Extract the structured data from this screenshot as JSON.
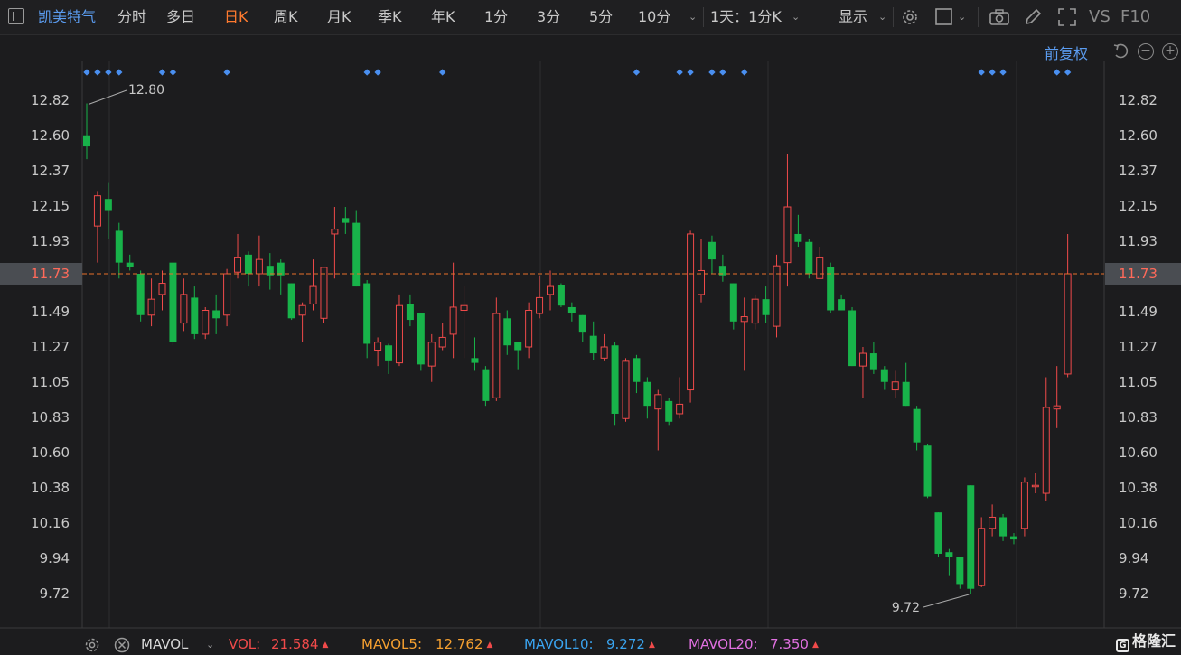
{
  "toolbar": {
    "stock_name": "凯美特气",
    "periods": [
      "分时",
      "多日",
      "日K",
      "周K",
      "月K",
      "季K",
      "年K",
      "1分",
      "3分",
      "5分",
      "10分"
    ],
    "active_period": "日K",
    "interval_select": "1天：1分K",
    "display_label": "显示",
    "vs_label": "VS",
    "f10_label": "F10"
  },
  "subbar": {
    "adjust_label": "前复权"
  },
  "price_axis": {
    "ticks": [
      "12.82",
      "12.60",
      "12.37",
      "12.15",
      "11.93",
      "11.73",
      "11.49",
      "11.27",
      "11.05",
      "10.83",
      "10.60",
      "10.38",
      "10.16",
      "9.94",
      "9.72"
    ],
    "current_price": "11.73"
  },
  "annotations": {
    "high_label": "12.80",
    "low_label": "9.72"
  },
  "colors": {
    "up": "#f04a4a",
    "down": "#18b34a",
    "marker": "#4a8ff0",
    "current_line": "#e8702a"
  },
  "chart_data": {
    "type": "candlestick",
    "y_range": [
      9.55,
      12.92
    ],
    "candles": [
      [
        12.6,
        12.53,
        12.8,
        12.45
      ],
      [
        12.03,
        12.22,
        12.25,
        11.8
      ],
      [
        12.2,
        12.13,
        12.3,
        11.95
      ],
      [
        12.0,
        11.8,
        12.05,
        11.7
      ],
      [
        11.8,
        11.77,
        11.85,
        11.75
      ],
      [
        11.73,
        11.47,
        11.75,
        11.43
      ],
      [
        11.47,
        11.57,
        11.7,
        11.4
      ],
      [
        11.6,
        11.67,
        11.75,
        11.5
      ],
      [
        11.8,
        11.3,
        11.8,
        11.28
      ],
      [
        11.42,
        11.6,
        11.7,
        11.37
      ],
      [
        11.58,
        11.35,
        11.65,
        11.32
      ],
      [
        11.35,
        11.5,
        11.52,
        11.32
      ],
      [
        11.5,
        11.45,
        11.6,
        11.35
      ],
      [
        11.47,
        11.73,
        11.76,
        11.4
      ],
      [
        11.74,
        11.83,
        11.98,
        11.7
      ],
      [
        11.85,
        11.73,
        11.87,
        11.65
      ],
      [
        11.73,
        11.82,
        11.97,
        11.65
      ],
      [
        11.78,
        11.72,
        11.86,
        11.63
      ],
      [
        11.8,
        11.72,
        11.82,
        11.6
      ],
      [
        11.67,
        11.45,
        11.67,
        11.44
      ],
      [
        11.47,
        11.53,
        11.55,
        11.3
      ],
      [
        11.54,
        11.65,
        11.82,
        11.5
      ],
      [
        11.45,
        11.77,
        11.77,
        11.42
      ],
      [
        11.98,
        12.01,
        12.15,
        11.7
      ],
      [
        12.08,
        12.05,
        12.15,
        11.98
      ],
      [
        12.05,
        11.65,
        12.13,
        11.65
      ],
      [
        11.67,
        11.29,
        11.69,
        11.2
      ],
      [
        11.25,
        11.3,
        11.33,
        11.15
      ],
      [
        11.28,
        11.18,
        11.29,
        11.1
      ],
      [
        11.17,
        11.53,
        11.6,
        11.15
      ],
      [
        11.54,
        11.44,
        11.6,
        11.4
      ],
      [
        11.48,
        11.16,
        11.48,
        11.12
      ],
      [
        11.15,
        11.3,
        11.35,
        11.05
      ],
      [
        11.27,
        11.33,
        11.42,
        11.25
      ],
      [
        11.35,
        11.52,
        11.8,
        11.2
      ],
      [
        11.5,
        11.53,
        11.65,
        11.2
      ],
      [
        11.2,
        11.17,
        11.33,
        11.12
      ],
      [
        11.13,
        10.93,
        11.15,
        10.9
      ],
      [
        10.95,
        11.48,
        11.58,
        10.93
      ],
      [
        11.45,
        11.28,
        11.5,
        11.22
      ],
      [
        11.3,
        11.25,
        11.3,
        11.13
      ],
      [
        11.27,
        11.5,
        11.55,
        11.2
      ],
      [
        11.48,
        11.58,
        11.72,
        11.45
      ],
      [
        11.6,
        11.65,
        11.75,
        11.5
      ],
      [
        11.66,
        11.53,
        11.67,
        11.52
      ],
      [
        11.52,
        11.48,
        11.55,
        11.43
      ],
      [
        11.47,
        11.36,
        11.47,
        11.3
      ],
      [
        11.34,
        11.23,
        11.43,
        11.19
      ],
      [
        11.2,
        11.27,
        11.35,
        11.18
      ],
      [
        11.28,
        10.85,
        11.3,
        10.78
      ],
      [
        10.82,
        11.18,
        11.2,
        10.8
      ],
      [
        11.2,
        11.05,
        11.22,
        10.98
      ],
      [
        11.05,
        10.9,
        11.08,
        10.82
      ],
      [
        10.88,
        10.97,
        11.0,
        10.62
      ],
      [
        10.93,
        10.8,
        10.95,
        10.78
      ],
      [
        10.85,
        10.91,
        11.08,
        10.82
      ],
      [
        11.0,
        11.98,
        12.0,
        10.92
      ],
      [
        11.6,
        11.75,
        11.95,
        11.55
      ],
      [
        11.93,
        11.82,
        11.97,
        11.73
      ],
      [
        11.78,
        11.72,
        11.85,
        11.68
      ],
      [
        11.67,
        11.43,
        11.67,
        11.38
      ],
      [
        11.43,
        11.46,
        11.58,
        11.12
      ],
      [
        11.42,
        11.57,
        11.6,
        11.38
      ],
      [
        11.57,
        11.47,
        11.65,
        11.42
      ],
      [
        11.4,
        11.78,
        11.85,
        11.33
      ],
      [
        11.8,
        12.15,
        12.48,
        11.65
      ],
      [
        11.98,
        11.93,
        12.1,
        11.9
      ],
      [
        11.93,
        11.73,
        11.95,
        11.7
      ],
      [
        11.7,
        11.83,
        11.9,
        11.7
      ],
      [
        11.77,
        11.5,
        11.8,
        11.48
      ],
      [
        11.57,
        11.5,
        11.6,
        11.5
      ],
      [
        11.5,
        11.15,
        11.52,
        11.15
      ],
      [
        11.15,
        11.23,
        11.27,
        10.95
      ],
      [
        11.23,
        11.13,
        11.3,
        11.1
      ],
      [
        11.13,
        11.05,
        11.15,
        11.0
      ],
      [
        11.0,
        11.05,
        11.12,
        10.95
      ],
      [
        11.05,
        10.9,
        11.17,
        10.9
      ],
      [
        10.88,
        10.67,
        10.9,
        10.62
      ],
      [
        10.65,
        10.33,
        10.66,
        10.32
      ],
      [
        10.23,
        9.97,
        10.23,
        9.95
      ],
      [
        9.98,
        9.95,
        10.0,
        9.83
      ],
      [
        9.95,
        9.78,
        9.95,
        9.75
      ],
      [
        10.4,
        9.75,
        10.4,
        9.72
      ],
      [
        9.77,
        10.13,
        10.2,
        9.76
      ],
      [
        10.13,
        10.2,
        10.28,
        10.08
      ],
      [
        10.2,
        10.08,
        10.22,
        10.05
      ],
      [
        10.08,
        10.06,
        10.1,
        10.03
      ],
      [
        10.13,
        10.42,
        10.45,
        10.08
      ],
      [
        10.4,
        10.4,
        10.48,
        10.35
      ],
      [
        10.35,
        10.89,
        11.08,
        10.3
      ],
      [
        10.88,
        10.9,
        11.15,
        10.76
      ],
      [
        11.1,
        11.73,
        11.98,
        11.08
      ]
    ],
    "marker_indices": [
      0,
      1,
      2,
      3,
      7,
      8,
      13,
      26,
      27,
      33,
      51,
      55,
      56,
      58,
      59,
      61,
      83,
      84,
      85,
      90,
      91
    ]
  },
  "bottom": {
    "indicator_name": "MAVOL",
    "vol_label": "VOL:",
    "vol_value": "21.584",
    "mavol5_label": "MAVOL5:",
    "mavol5_value": "12.762",
    "mavol10_label": "MAVOL10:",
    "mavol10_value": "9.272",
    "mavol20_label": "MAVOL20:",
    "mavol20_value": "7.350",
    "brand": "格隆汇"
  }
}
